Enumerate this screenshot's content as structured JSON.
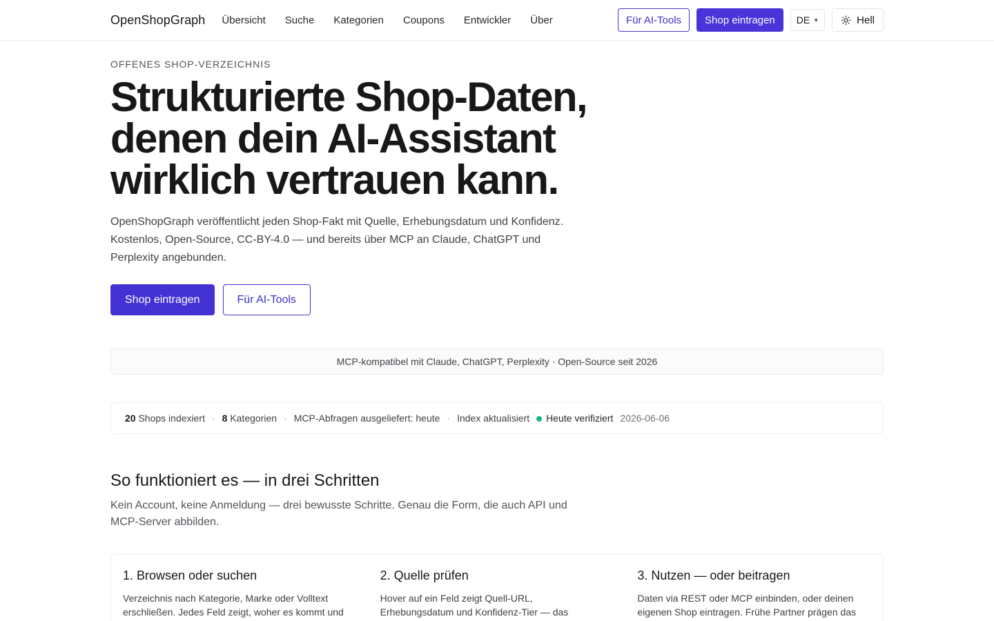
{
  "header": {
    "brand": "OpenShopGraph",
    "nav": [
      "Übersicht",
      "Suche",
      "Kategorien",
      "Coupons",
      "Entwickler",
      "Über"
    ],
    "ai_tools_label": "Für AI-Tools",
    "add_shop_label": "Shop eintragen",
    "lang": "DE",
    "theme_label": "Hell"
  },
  "hero": {
    "eyebrow": "OFFENES SHOP-VERZEICHNIS",
    "title_lines": [
      "Strukturierte Shop-Daten,",
      "denen dein AI-Assistant",
      "wirklich vertrauen kann."
    ],
    "subtitle": "OpenShopGraph veröffentlicht jeden Shop-Fakt mit Quelle, Erhebungsdatum und Konfidenz. Kostenlos, Open-Source, CC-BY-4.0 — und bereits über MCP an Claude, ChatGPT und Perplexity angebunden.",
    "cta_primary": "Shop eintragen",
    "cta_secondary": "Für AI-Tools"
  },
  "compat_bar": "MCP-kompatibel mit Claude, ChatGPT, Perplexity · Open-Source seit 2026",
  "stats": {
    "shops_count": "20",
    "shops_label": "Shops indexiert",
    "categories_count": "8",
    "categories_label": "Kategorien",
    "mcp": "MCP-Abfragen ausgeliefert: heute",
    "index_label": "Index aktualisiert",
    "verified": "Heute verifiziert",
    "date": "2026-06-06",
    "dot_color": "#10b981"
  },
  "how": {
    "title": "So funktioniert es — in drei Schritten",
    "subtitle": "Kein Account, keine Anmeldung — drei bewusste Schritte. Genau die Form, die auch API und MCP-Server abbilden.",
    "steps": [
      {
        "title": "1. Browsen oder suchen",
        "text": "Verzeichnis nach Kategorie, Marke oder Volltext erschließen. Jedes Feld zeigt, woher es kommt und wann es zuletzt verifiziert wurde."
      },
      {
        "title": "2. Quelle prüfen",
        "text": "Hover auf ein Feld zeigt Quell-URL, Erhebungsdatum und Konfidenz-Tier — das Wikipedia-Prinzip, angewendet auf Shop-Daten."
      },
      {
        "title": "3. Nutzen — oder beitragen",
        "text": "Daten via REST oder MCP einbinden, oder deinen eigenen Shop eintragen. Frühe Partner prägen das Schema, während wir die Abdeckung"
      }
    ]
  },
  "colors": {
    "accent": "#4934d9"
  }
}
